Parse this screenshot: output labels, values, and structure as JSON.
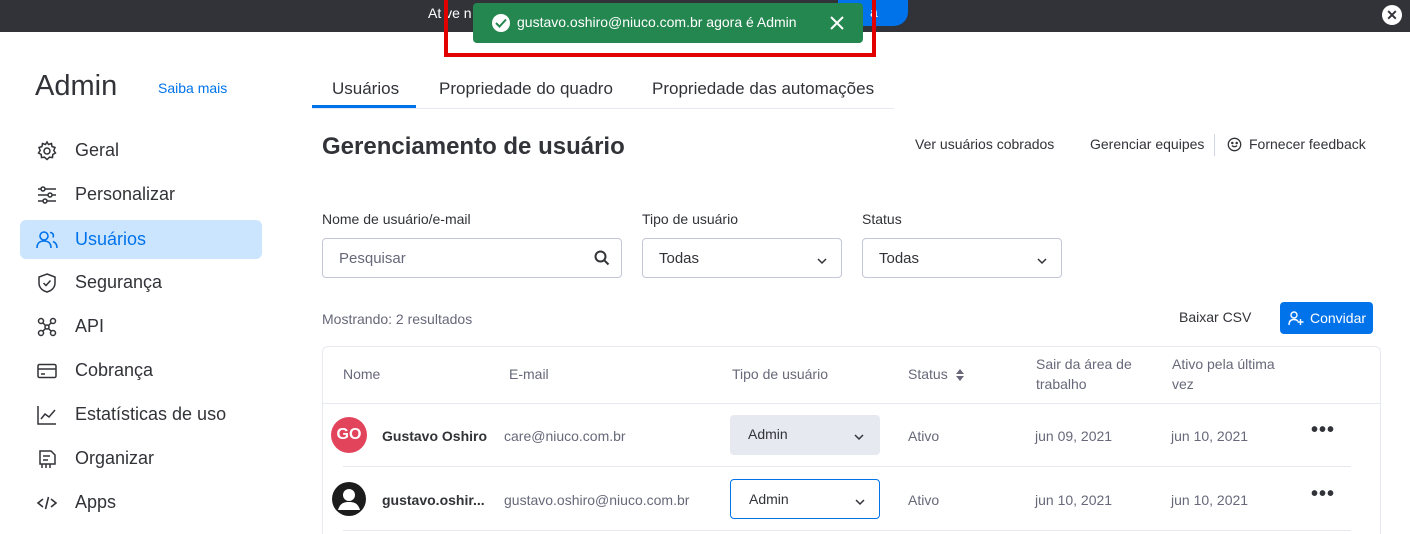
{
  "topbar": {
    "text": "At ve n",
    "button_label": "a",
    "close_glyph": "✕"
  },
  "toast": {
    "message": "gustavo.oshiro@niuco.com.br agora é Admin"
  },
  "sidebar": {
    "title": "Admin",
    "learn_more": "Saiba mais",
    "items": [
      {
        "label": "Geral",
        "icon": "gear-icon"
      },
      {
        "label": "Personalizar",
        "icon": "sliders-icon"
      },
      {
        "label": "Usuários",
        "icon": "users-icon"
      },
      {
        "label": "Segurança",
        "icon": "shield-icon"
      },
      {
        "label": "API",
        "icon": "api-icon"
      },
      {
        "label": "Cobrança",
        "icon": "credit-card-icon"
      },
      {
        "label": "Estatísticas de uso",
        "icon": "chart-icon"
      },
      {
        "label": "Organizar",
        "icon": "organize-icon"
      },
      {
        "label": "Apps",
        "icon": "code-icon"
      }
    ]
  },
  "tabs": [
    {
      "label": "Usuários"
    },
    {
      "label": "Propriedade do quadro"
    },
    {
      "label": "Propriedade das automações"
    }
  ],
  "page": {
    "title": "Gerenciamento de usuário",
    "link_billed": "Ver usuários cobrados",
    "link_teams": "Gerenciar equipes",
    "link_feedback": "Fornecer feedback"
  },
  "filters": {
    "name_label": "Nome de usuário/e-mail",
    "search_placeholder": "Pesquisar",
    "type_label": "Tipo de usuário",
    "type_value": "Todas",
    "status_label": "Status",
    "status_value": "Todas"
  },
  "results": {
    "showing": "Mostrando: 2 resultados",
    "csv": "Baixar CSV",
    "invite": "Convidar"
  },
  "table": {
    "headers": {
      "name": "Nome",
      "email": "E-mail",
      "type": "Tipo de usuário",
      "status": "Status",
      "left_line1": "Sair da área de",
      "left_line2": "trabalho",
      "active_line1": "Ativo pela última",
      "active_line2": "vez"
    },
    "rows": [
      {
        "initials": "GO",
        "name": "Gustavo Oshiro",
        "email": "care@niuco.com.br",
        "type": "Admin",
        "status": "Ativo",
        "left_date": "jun 09, 2021",
        "active_date": "jun 10, 2021"
      },
      {
        "initials": "",
        "name": "gustavo.oshir...",
        "email": "gustavo.oshiro@niuco.com.br",
        "type": "Admin",
        "status": "Ativo",
        "left_date": "jun 10, 2021",
        "active_date": "jun 10, 2021"
      }
    ]
  },
  "colors": {
    "accent": "#0073ea",
    "toast_green": "#258750",
    "highlight_red": "#e00000",
    "avatar_red": "#e2445c",
    "active_bg": "#cce5ff"
  }
}
